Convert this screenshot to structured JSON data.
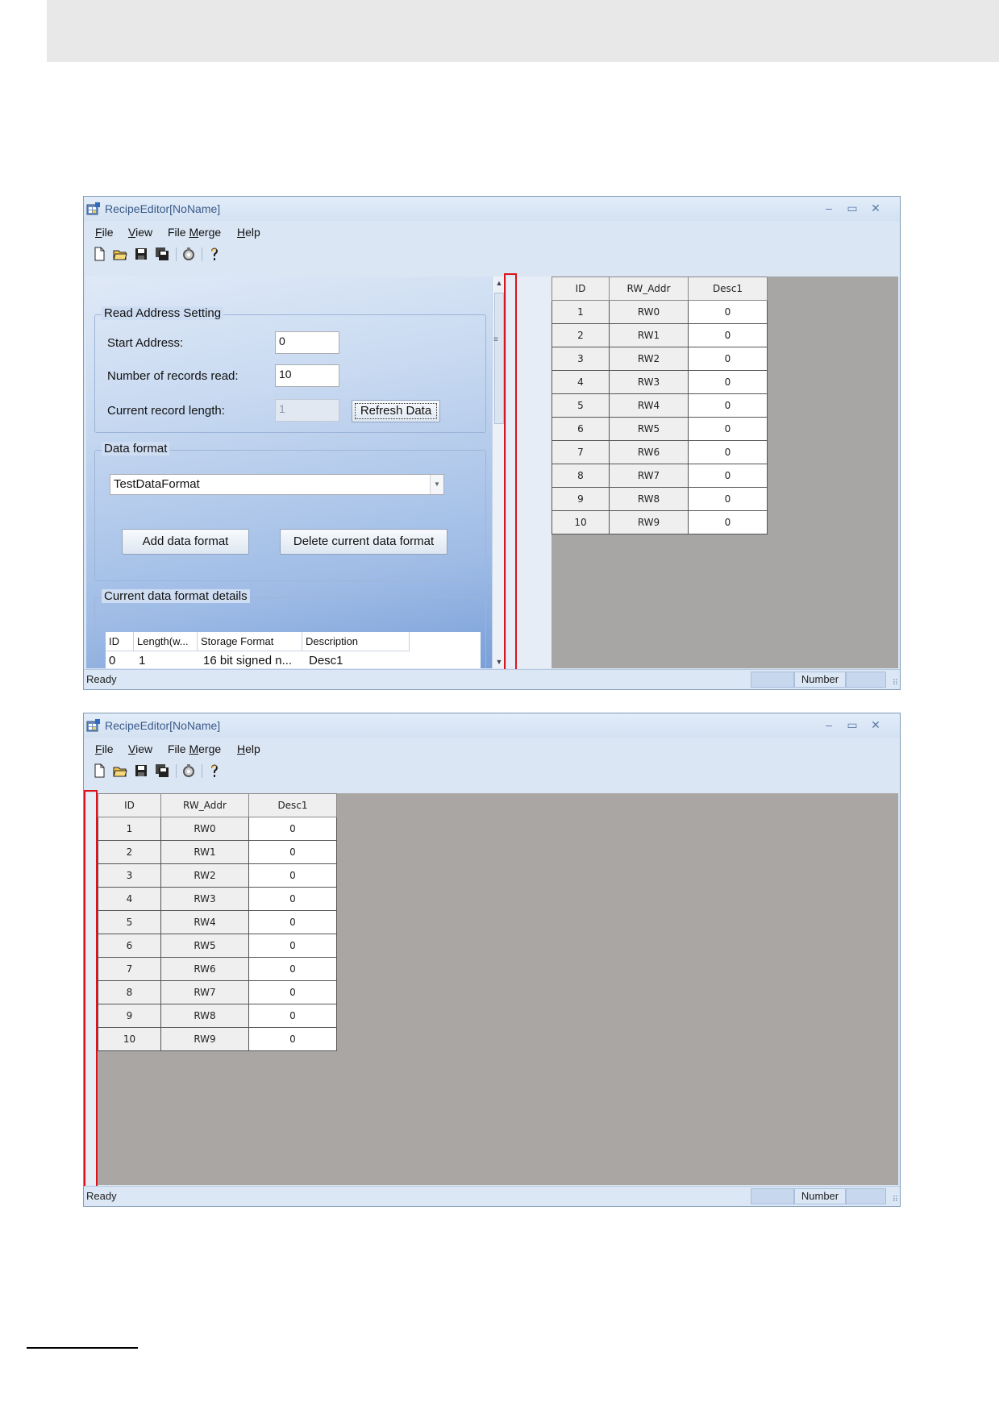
{
  "window": {
    "title": "RecipeEditor[NoName]",
    "minimize": "–",
    "maximize": "▭",
    "close": "✕"
  },
  "menu": {
    "file": {
      "key": "F",
      "rest": "ile"
    },
    "view": {
      "key": "V",
      "rest": "iew"
    },
    "file_merge": {
      "pre": "File ",
      "key": "M",
      "rest": "erge"
    },
    "help": {
      "key": "H",
      "rest": "elp"
    }
  },
  "toolbar": [
    "new-file-icon",
    "open-folder-icon",
    "save-icon",
    "save-all-icon",
    "settings-icon",
    "help-icon"
  ],
  "read_address": {
    "group_title": "Read Address Setting",
    "start_address_label": "Start Address:",
    "start_address_value": "0",
    "num_records_label": "Number of records read:",
    "num_records_value": "10",
    "record_length_label": "Current record length:",
    "record_length_value": "1",
    "refresh_button": "Refresh Data"
  },
  "data_format": {
    "group_title": "Data format",
    "selected": "TestDataFormat",
    "add_button": "Add data format",
    "delete_button": "Delete current data format"
  },
  "format_details": {
    "group_title": "Current data format details",
    "columns": [
      "ID",
      "Length(w...",
      "Storage Format",
      "Description"
    ],
    "row": [
      "0",
      "1",
      "16 bit signed n...",
      "Desc1"
    ]
  },
  "grid": {
    "headers": [
      "ID",
      "RW_Addr",
      "Desc1"
    ],
    "rows": [
      [
        "1",
        "RW0",
        "0"
      ],
      [
        "2",
        "RW1",
        "0"
      ],
      [
        "3",
        "RW2",
        "0"
      ],
      [
        "4",
        "RW3",
        "0"
      ],
      [
        "5",
        "RW4",
        "0"
      ],
      [
        "6",
        "RW5",
        "0"
      ],
      [
        "7",
        "RW6",
        "0"
      ],
      [
        "8",
        "RW7",
        "0"
      ],
      [
        "9",
        "RW8",
        "0"
      ],
      [
        "10",
        "RW9",
        "0"
      ]
    ]
  },
  "status": {
    "ready": "Ready",
    "mode": "Number"
  },
  "colors": {
    "highlight": "#d9141c",
    "grid_background": "#a8a6a4"
  }
}
